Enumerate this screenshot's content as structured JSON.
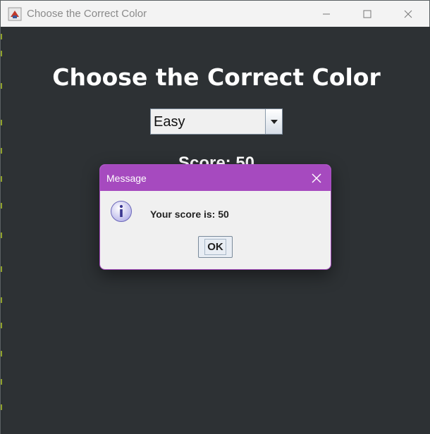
{
  "window": {
    "title": "Choose the Correct Color",
    "icon": "java-app-icon",
    "controls": [
      "minimize-icon",
      "maximize-icon",
      "close-icon"
    ]
  },
  "main": {
    "heading": "Choose the Correct Color",
    "difficulty": {
      "selected": "Easy",
      "dropdown_icon": "chevron-down-icon"
    },
    "score_text": "Score: 50"
  },
  "dialog": {
    "title": "Message",
    "icon": "info-icon",
    "message": "Your score is: 50",
    "ok_label": "OK"
  },
  "colors": {
    "background": "#2d3134",
    "dialog_titlebar": "#a64abf",
    "text_light": "#ffffff"
  }
}
